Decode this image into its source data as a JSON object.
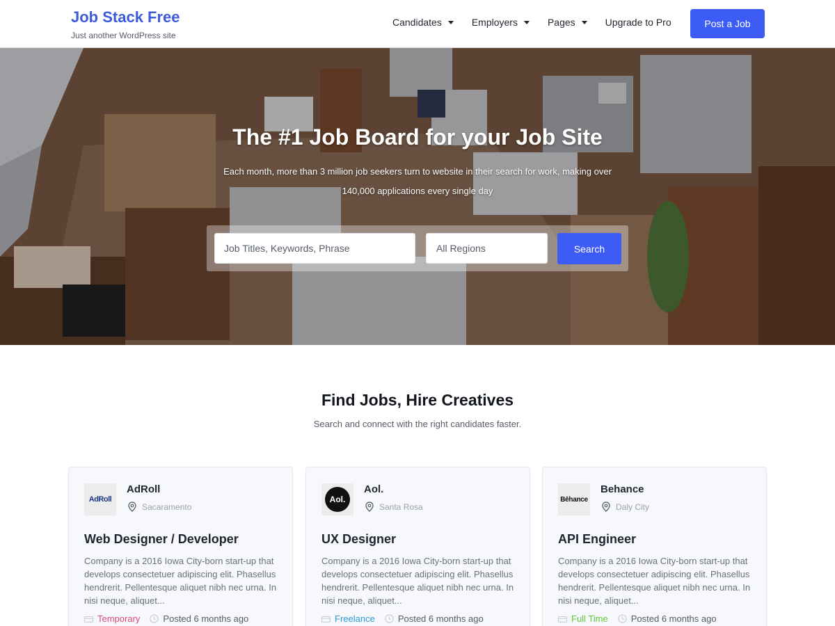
{
  "header": {
    "brand_title": "Job Stack Free",
    "brand_tagline": "Just another WordPress site",
    "nav": [
      {
        "label": "Candidates",
        "dropdown": true
      },
      {
        "label": "Employers",
        "dropdown": true
      },
      {
        "label": "Pages",
        "dropdown": true
      },
      {
        "label": "Upgrade to Pro",
        "dropdown": false
      }
    ],
    "cta_label": "Post a Job"
  },
  "hero": {
    "title": "The #1 Job Board for your Job Site",
    "subtitle": "Each month, more than 3 million job seekers turn to website in their search for work, making over 140,000 applications every single day",
    "search": {
      "keyword_placeholder": "Job Titles, Keywords, Phrase",
      "region_value": "All Regions",
      "button_label": "Search"
    }
  },
  "section": {
    "title": "Find Jobs, Hire Creatives",
    "subtitle": "Search and connect with the right candidates faster."
  },
  "jobs": [
    {
      "logo_text": "AdRoll",
      "company": "AdRoll",
      "location": "Sacaramento",
      "title": "Web Designer / Developer",
      "description": "Company is a 2016 Iowa City-born start-up that develops consectetuer adipiscing elit. Phasellus hendrerit. Pellentesque aliquet nibh nec urna. In nisi neque, aliquet...",
      "type": "Temporary",
      "type_color": "#e0487a",
      "posted": "Posted 6 months ago"
    },
    {
      "logo_text": "Aol.",
      "company": "Aol.",
      "location": "Santa Rosa",
      "title": "UX Designer",
      "description": "Company is a 2016 Iowa City-born start-up that develops consectetuer adipiscing elit. Phasellus hendrerit. Pellentesque aliquet nibh nec urna. In nisi neque, aliquet...",
      "type": "Freelance",
      "type_color": "#2e9bd6",
      "posted": "Posted 6 months ago"
    },
    {
      "logo_text": "Bēhance",
      "company": "Behance",
      "location": "Daly City",
      "title": "API Engineer",
      "description": "Company is a 2016 Iowa City-born start-up that develops consectetuer adipiscing elit. Phasellus hendrerit. Pellentesque aliquet nibh nec urna. In nisi neque, aliquet...",
      "type": "Full Time",
      "type_color": "#5cc93a",
      "posted": "Posted 6 months ago"
    }
  ],
  "colors": {
    "accent": "#3d5cf5",
    "brand": "#3b5bdb"
  },
  "icons": {
    "nav_dropdown": "chevron-down-icon",
    "location": "map-pin-icon",
    "job_type": "briefcase-icon",
    "posted": "clock-icon"
  }
}
